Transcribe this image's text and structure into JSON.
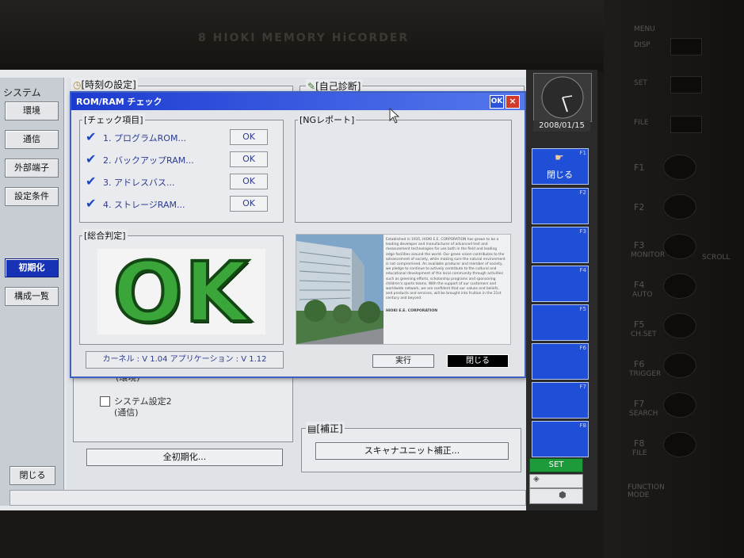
{
  "hardware": {
    "top_text": "8 HIOKI MEMORY HiCORDER",
    "menu_label": "MENU",
    "f_labels": [
      "F1",
      "F2",
      "F3",
      "F4",
      "F5",
      "F6",
      "F7",
      "F8"
    ],
    "f_captions": [
      "MONITOR",
      "AUTO",
      "CH.SET",
      "TRIGGER",
      "SEARCH",
      "FILE"
    ],
    "side_labels": [
      "DISP",
      "SET",
      "FILE"
    ],
    "scroll_label": "SCROLL",
    "function_mode": "FUNCTION MODE"
  },
  "sidebar": {
    "title": "システム",
    "items": [
      {
        "label": "環境",
        "active": false
      },
      {
        "label": "通信",
        "active": false
      },
      {
        "label": "外部端子",
        "active": false
      },
      {
        "label": "設定条件",
        "active": false
      },
      {
        "label": "初期化",
        "active": true
      },
      {
        "label": "構成一覧",
        "active": false
      }
    ],
    "close_label": "閉じる"
  },
  "main": {
    "time_section_label": "[時刻の設定]",
    "diag_section_label": "[自己診断]",
    "env_label": "(環境)",
    "sys_setting2_label": "システム設定2",
    "comm_label": "(通信)",
    "all_init_button": "全初期化...",
    "correction_label": "[補正]",
    "scanner_button": "スキャナユニット補正..."
  },
  "dialog": {
    "title": "ROM/RAM チェック",
    "title_ok": "OK",
    "title_close": "×",
    "check_items_label": "[チェック項目]",
    "check_items": [
      {
        "label": "1. プログラムROM...",
        "result": "OK"
      },
      {
        "label": "2. バックアップRAM...",
        "result": "OK"
      },
      {
        "label": "3. アドレスバス...",
        "result": "OK"
      },
      {
        "label": "4. ストレージRAM...",
        "result": "OK"
      }
    ],
    "ng_report_label": "[NGレポート]",
    "overall_label": "[総合判定]",
    "overall_result": "OK",
    "version": "カーネル : V 1.04  アプリケーション : V 1.12",
    "execute_button": "実行",
    "close_button": "閉じる",
    "photo_text": "Established in 1935, HIOKI E.E. CORPORATION has grown to be a leading developer and manufacturer of advanced test and measurement technologies for use both in the field and leading edge facilities around the world. Our green vision contributes to the advancement of society, while making sure the natural environment is not compromised. An available producer and member of society, we pledge to continue to actively contribute to the cultural and educational development of the local community through activities such as greening efforts, scholarship programs and sponsoring children's sports teams. With the support of our customers and worldwide network, we are confident that our values and beliefs, and products and services, will be brought into fruition in the 21st century and beyond.",
    "photo_corp": "HIOKI E.E. CORPORATION"
  },
  "right_panel": {
    "date": "2008/01/15",
    "close_label": "閉じる",
    "set_label": "SET"
  },
  "colors": {
    "accent_blue": "#1f4fd6",
    "ok_green": "#3aa63a",
    "set_green": "#1d9a3a"
  }
}
